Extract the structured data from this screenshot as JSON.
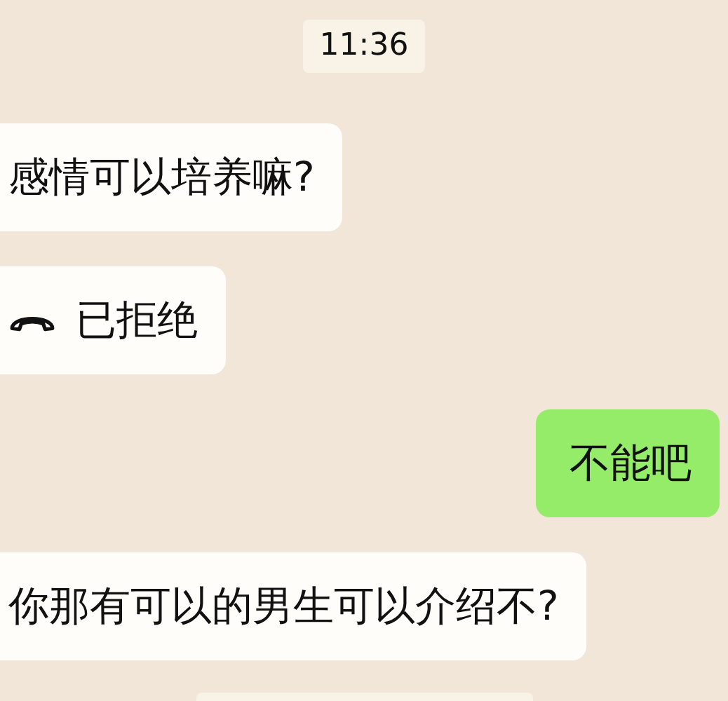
{
  "timestamp": "11:36",
  "messages": [
    {
      "kind": "text",
      "outgoing": false,
      "text": "感情可以培养嘛?"
    },
    {
      "kind": "call",
      "outgoing": false,
      "text": "已拒绝"
    },
    {
      "kind": "text",
      "outgoing": true,
      "text": "不能吧"
    },
    {
      "kind": "text",
      "outgoing": false,
      "text": "你那有可以的男生可以介绍不?"
    }
  ]
}
